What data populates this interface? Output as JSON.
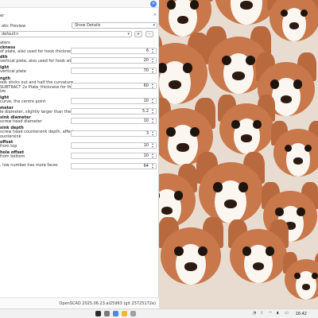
{
  "window": {
    "close_icon": "x-mark-icon",
    "close_glyph": "×"
  },
  "panel": {
    "title": "er",
    "close_glyph": "×"
  },
  "preview": {
    "label": "atic Preview",
    "selected": "Show Details"
  },
  "preset": {
    "selected": "default>",
    "add_label": "+",
    "remove_label": "-"
  },
  "params_header": "aters",
  "parameters": [
    {
      "name": "ckness",
      "desc": [
        "of plate, also used for hook thickness"
      ],
      "value": "6"
    },
    {
      "name": "dth",
      "desc": [
        "vertical plate, also used for hook width"
      ],
      "value": "20"
    },
    {
      "name": "ight",
      "desc": [
        "vertical plate"
      ],
      "value": "70"
    },
    {
      "name": "ngth",
      "desc": [
        "ook sticks out and half the curvature",
        "SUBTRACT 2x Plate_thickness for the",
        "ize"
      ],
      "value": "60"
    },
    {
      "name": "ight",
      "desc": [
        "curve, the centre point"
      ],
      "value": "10"
    },
    {
      "name": "meter",
      "desc": [
        "le diameter, slightly larger than the thread"
      ],
      "value": "5.2"
    },
    {
      "name": "sink diameter",
      "desc": [
        "screw head diameter"
      ],
      "value": "10"
    },
    {
      "name": "sink depth",
      "desc": [
        "screw head countersink depth, affects",
        "ountersink"
      ],
      "value": "3"
    },
    {
      "name": "offset",
      "desc": [
        "from top"
      ],
      "value": "10"
    },
    {
      "name": "hole offset",
      "desc": [
        "from bottom"
      ],
      "value": "10"
    },
    {
      "name": "",
      "desc": [
        ", low number has more faces"
      ],
      "value": "64"
    }
  ],
  "status": {
    "version": "OpenSCAD 2025.06.23.ai25963 (git 25725172e)"
  },
  "taskbar": {
    "clock": "16:42"
  },
  "colors": {
    "accent": "#3b82f6",
    "dog_fur": "#c8784a",
    "dog_face": "#fbf6ef"
  }
}
